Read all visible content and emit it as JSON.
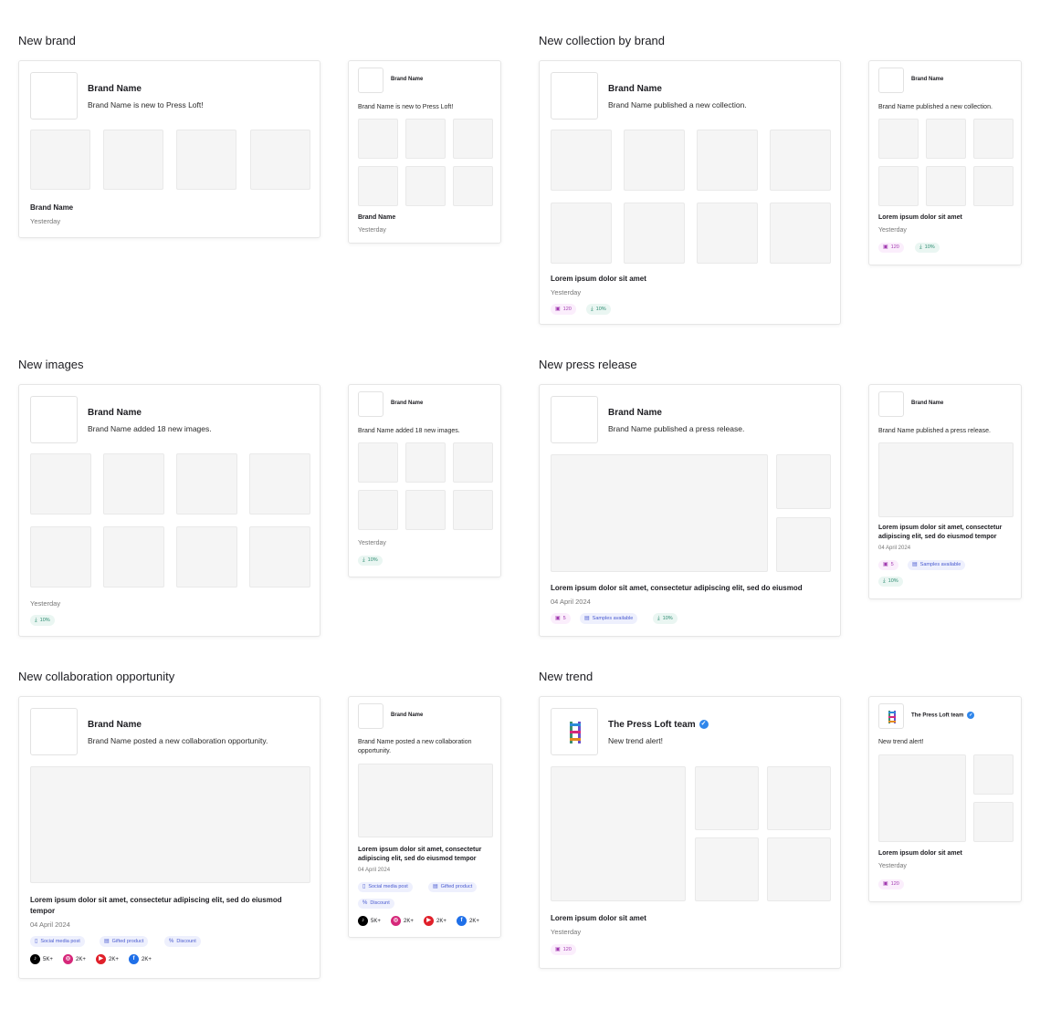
{
  "sections": {
    "new_brand": "New brand",
    "new_collection": "New collection by brand",
    "new_images": "New images",
    "new_press": "New press release",
    "new_collab": "New collaboration opportunity",
    "new_trend": "New trend"
  },
  "brand_name": "Brand Name",
  "team_name": "The Press Loft team",
  "msgs": {
    "new_brand": "Brand Name is new to Press Loft!",
    "new_collection": "Brand Name published a new collection.",
    "new_images": "Brand Name added 18 new images.",
    "new_press": "Brand Name published a press release.",
    "new_collab": "Brand Name posted a new collaboration opportunity.",
    "new_trend": "New trend alert!"
  },
  "lorem_short": "Lorem ipsum dolor sit amet",
  "lorem_long": "Lorem ipsum dolor sit amet, consectetur adipiscing elit, sed do eiusmod tempor",
  "press_title": "Lorem ipsum dolor sit amet, consectetur adipiscing elit, sed do eiusmod",
  "yesterday": "Yesterday",
  "date": "04 April 2024",
  "chips": {
    "images_120": "120",
    "images_5": "5",
    "downloads": "10%",
    "samples": "Samples available",
    "social": "Social media post",
    "gifted": "Gifted product",
    "discount": "Discount"
  },
  "socials": {
    "tiktok": "5K+",
    "instagram": "2K+",
    "youtube": "2K+",
    "facebook": "2K+"
  },
  "colors": {
    "chip_pink": "#a23bb0",
    "chip_teal": "#2a8a6f",
    "chip_blue": "#4a5bd0",
    "verified": "#2f86eb",
    "tiktok": "#000000",
    "instagram": "#d6287a",
    "youtube": "#e0202a",
    "facebook": "#1f6fe8"
  },
  "icons": [
    "images-icon",
    "download-icon",
    "calendar-icon",
    "phone-icon",
    "gift-icon",
    "discount-icon",
    "verified-icon",
    "tiktok-icon",
    "instagram-icon",
    "youtube-icon",
    "facebook-icon",
    "press-loft-logo"
  ]
}
